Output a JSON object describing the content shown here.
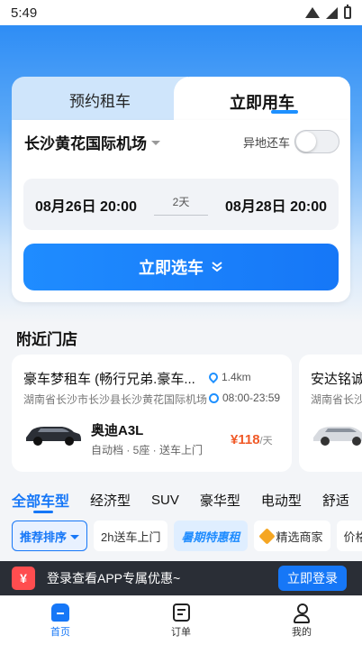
{
  "status_bar": {
    "time": "5:49"
  },
  "booking": {
    "tab_reserve": "预约租车",
    "tab_instant": "立即用车",
    "location": "长沙黄花国际机场",
    "return_diff_label": "异地还车",
    "return_diff_enabled": false,
    "pickup": "08月26日 20:00",
    "duration": "2天",
    "dropoff": "08月28日 20:00",
    "select_button": "立即选车"
  },
  "nearby": {
    "title": "附近门店",
    "stores": [
      {
        "name": "豪车梦租车 (畅行兄弟.豪车...",
        "distance": "1.4km",
        "address": "湖南省长沙市长沙县长沙黄花国际机场",
        "hours": "08:00-23:59",
        "car_model": "奥迪A3L",
        "car_spec": "自动档 · 5座 · 送车上门",
        "price": "¥118",
        "price_unit": "/天"
      },
      {
        "name": "安达铭诚",
        "address": "湖南省长沙"
      }
    ]
  },
  "category_tabs": [
    "全部车型",
    "经济型",
    "SUV",
    "豪华型",
    "电动型",
    "舒适"
  ],
  "filters": [
    "推荐排序",
    "2h送车上门",
    "暑期特惠租",
    "精选商家",
    "价格/"
  ],
  "login_banner": {
    "coupon_icon": "¥",
    "text": "登录查看APP专属优惠~",
    "button": "立即登录"
  },
  "tabbar": [
    "首页",
    "订单",
    "我的"
  ],
  "colors": {
    "accent": "#1677f7",
    "price": "#f05a28"
  }
}
